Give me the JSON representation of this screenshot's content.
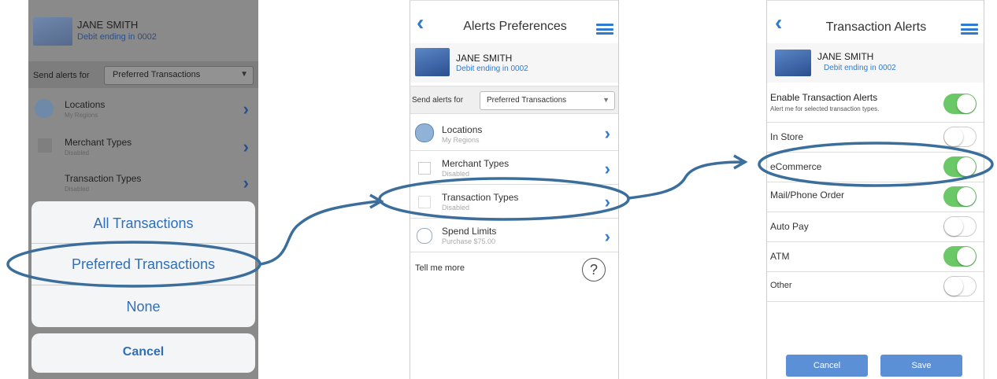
{
  "screen1": {
    "user_name": "JANE SMITH",
    "card_desc": "Debit ending in 0002",
    "send_alerts_label": "Send alerts for",
    "send_alerts_value": "Preferred Transactions",
    "menu": [
      {
        "title": "Locations",
        "sub": "My Regions"
      },
      {
        "title": "Merchant Types",
        "sub": "Disabled"
      },
      {
        "title": "Transaction Types",
        "sub": "Disabled"
      }
    ],
    "sheet_options": [
      "All Transactions",
      "Preferred Transactions",
      "None"
    ],
    "cancel": "Cancel"
  },
  "screen2": {
    "title": "Alerts Preferences",
    "user_name": "JANE SMITH",
    "card_desc": "Debit ending in 0002",
    "send_alerts_label": "Send alerts for",
    "send_alerts_value": "Preferred Transactions",
    "menu": [
      {
        "title": "Locations",
        "sub": "My Regions"
      },
      {
        "title": "Merchant Types",
        "sub": "Disabled"
      },
      {
        "title": "Transaction Types",
        "sub": "Disabled"
      },
      {
        "title": "Spend Limits",
        "sub": "Purchase $75.00"
      }
    ],
    "tell_me_more": "Tell me more",
    "help_icon": "?"
  },
  "screen3": {
    "title": "Transaction Alerts",
    "user_name": "JANE SMITH",
    "card_desc": "Debit ending in 0002",
    "enable_label": "Enable Transaction Alerts",
    "enable_sub": "Alert me for selected transaction types.",
    "enable_on": true,
    "toggles": [
      {
        "label": "In Store",
        "on": false
      },
      {
        "label": "eCommerce",
        "on": true
      },
      {
        "label": "Mail/Phone Order",
        "on": true
      },
      {
        "label": "Auto Pay",
        "on": false
      },
      {
        "label": "ATM",
        "on": true
      },
      {
        "label": "Other",
        "on": false
      }
    ],
    "cancel": "Cancel",
    "save": "Save"
  },
  "colors": {
    "accent": "#2f7bd0",
    "toggle_on": "#6ac866",
    "annotation": "#3c6e9c",
    "footer_button": "#5b8fd6"
  }
}
